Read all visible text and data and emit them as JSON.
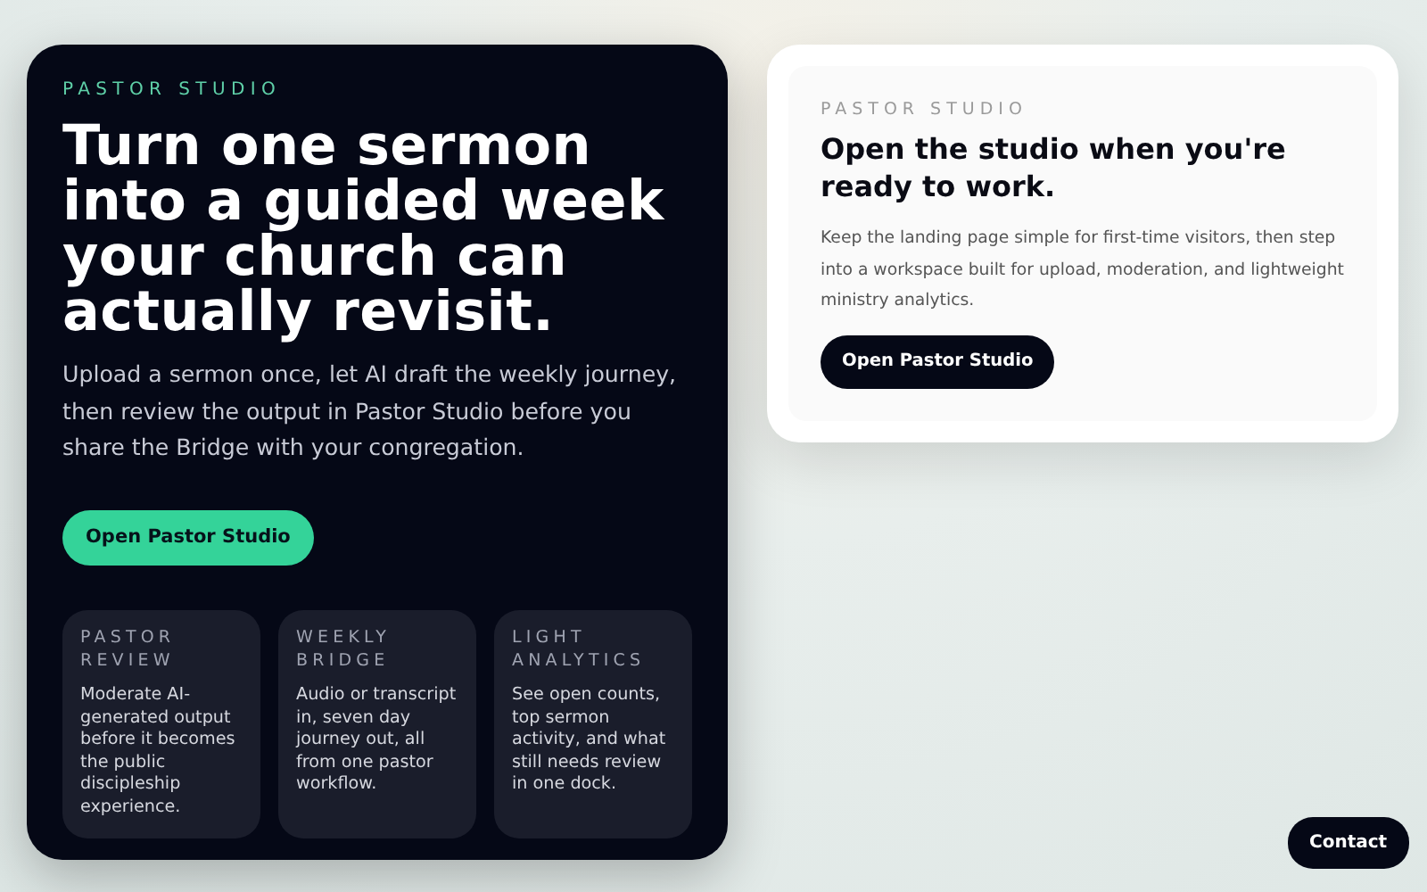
{
  "hero": {
    "eyebrow": "PASTOR STUDIO",
    "title": "Turn one sermon into a guided week your church can actually revisit.",
    "lead": "Upload a sermon once, let AI draft the weekly journey, then review the output in Pastor Studio before you share the Bridge with your congregation.",
    "button": "Open Pastor Studio",
    "features": [
      {
        "title": "PASTOR REVIEW",
        "text": "Moderate AI-generated output before it becomes the public discipleship experience."
      },
      {
        "title": "WEEKLY BRIDGE",
        "text": "Audio or transcript in, seven day journey out, all from one pastor workflow."
      },
      {
        "title": "LIGHT ANALYTICS",
        "text": "See open counts, top sermon activity, and what still needs review in one dock."
      }
    ]
  },
  "studio_card": {
    "eyebrow": "PASTOR STUDIO",
    "title": "Open the studio when you're ready to work.",
    "text": "Keep the landing page simple for first-time visitors, then step into a workspace built for upload, moderation, and lightweight ministry analytics.",
    "button": "Open Pastor Studio"
  },
  "contact_button": "Contact"
}
